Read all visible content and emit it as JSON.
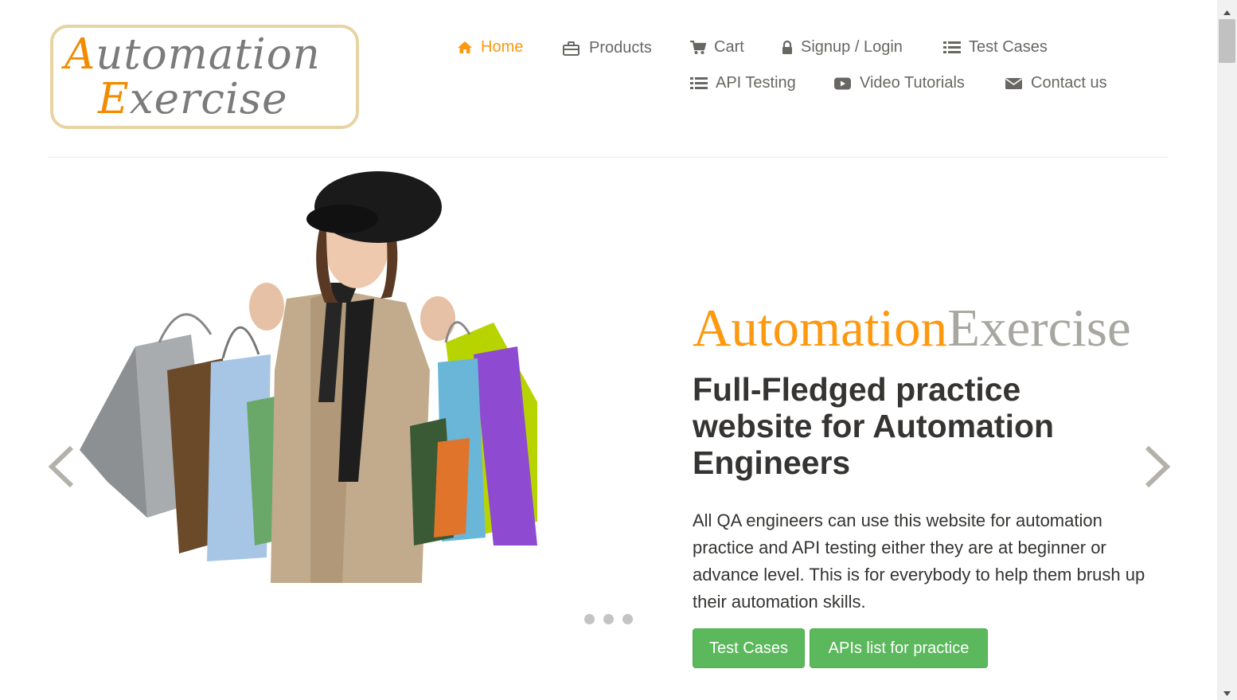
{
  "logo": {
    "line1_cap": "A",
    "line1_rest": "utomation",
    "line2_cap": "E",
    "line2_rest": "xercise"
  },
  "nav": {
    "items": [
      {
        "label": "Home",
        "icon": "home-icon",
        "active": true
      },
      {
        "label": "Products",
        "icon": "briefcase-icon"
      },
      {
        "label": "Cart",
        "icon": "shopping-cart-icon"
      },
      {
        "label": "Signup / Login",
        "icon": "lock-icon"
      },
      {
        "label": "Test Cases",
        "icon": "list-icon"
      },
      {
        "label": "API Testing",
        "icon": "list-icon"
      },
      {
        "label": "Video Tutorials",
        "icon": "youtube-play-icon"
      },
      {
        "label": "Contact us",
        "icon": "envelope-icon"
      }
    ]
  },
  "hero": {
    "brand_a": "Automation",
    "brand_b": "Exercise",
    "headline": "Full-Fledged practice website for Automation Engineers",
    "description": "All QA engineers can use this website for automation practice and API testing either they are at beginner or advance level. This is for everybody to help them brush up their automation skills.",
    "buttons": {
      "test_cases": "Test Cases",
      "apis_list": "APIs list for practice"
    },
    "carousel": {
      "slide_count": 3
    }
  },
  "colors": {
    "accent": "#fe980f",
    "brand_gray": "#a8a6a1",
    "button_green": "#5cb85c",
    "nav_text": "#696763"
  }
}
